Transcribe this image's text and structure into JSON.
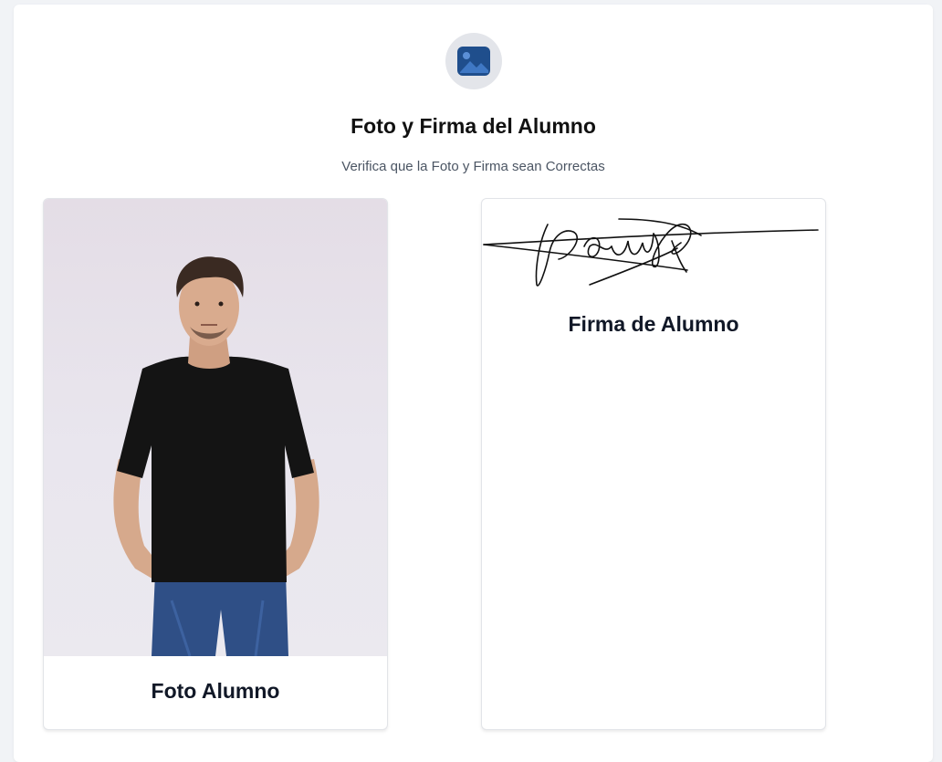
{
  "header": {
    "icon": "image-icon",
    "icon_color": "#1f4e8c",
    "title": "Foto y Firma del Alumno",
    "subtitle": "Verifica que la Foto y Firma sean Correctas"
  },
  "photo_card": {
    "label": "Foto Alumno",
    "image": "student-photo"
  },
  "signature_card": {
    "label": "Firma de Alumno",
    "image": "student-signature"
  }
}
